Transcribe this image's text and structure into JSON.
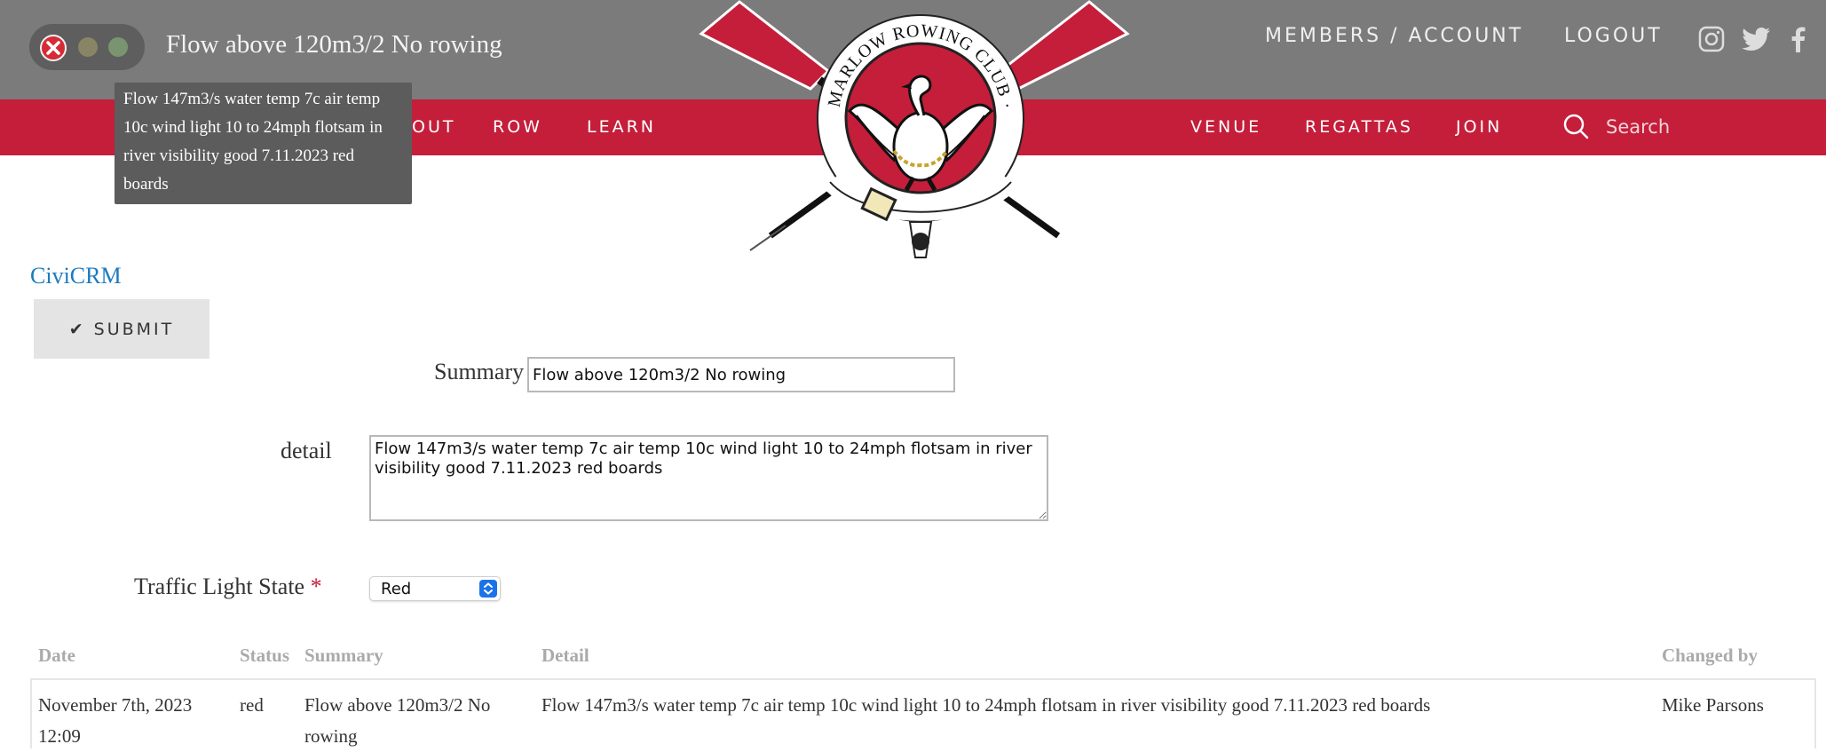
{
  "window": {
    "title": "Flow above 120m3/2 No rowing",
    "tooltip": "Flow 147m3/s water temp 7c air temp 10c wind light 10 to 24mph flotsam in river visibility good 7.11.2023 red boards"
  },
  "header": {
    "members_account": "MEMBERS / ACCOUNT",
    "logout": "LOGOUT",
    "social": [
      "instagram-icon",
      "twitter-icon",
      "facebook-icon"
    ],
    "logo_text": "MARLOW ROWING CLUB · 1871"
  },
  "nav": {
    "items": [
      "ABOUT",
      "ROW",
      "LEARN",
      "VENUE",
      "REGATTAS",
      "JOIN"
    ],
    "about_partial": "OUT",
    "search_placeholder": "Search"
  },
  "colors": {
    "brand_red": "#c41e3a",
    "topbar_gray": "#7b7b7b",
    "link_blue": "#1c7ac0"
  },
  "form": {
    "breadcrumb": "CiviCRM",
    "submit_label": "SUBMIT",
    "summary_label": "Summary",
    "summary_value": "Flow above 120m3/2 No rowing",
    "detail_label": "detail",
    "detail_value": "Flow 147m3/s water temp 7c air temp 10c wind light 10 to 24mph flotsam in river visibility good 7.11.2023 red boards",
    "traffic_label": "Traffic Light State",
    "required_mark": "*",
    "traffic_value": "Red"
  },
  "table": {
    "headers": [
      "Date",
      "Status",
      "Summary",
      "Detail",
      "Changed by"
    ],
    "rows": [
      {
        "date_line1": "November 7th, 2023",
        "date_line2": "12:09",
        "status": "red",
        "summary_line1": "Flow above 120m3/2 No",
        "summary_line2": "rowing",
        "detail": "Flow 147m3/s water temp 7c air temp 10c wind light 10 to 24mph flotsam in river visibility good 7.11.2023 red boards",
        "changed_by": "Mike Parsons"
      }
    ]
  }
}
